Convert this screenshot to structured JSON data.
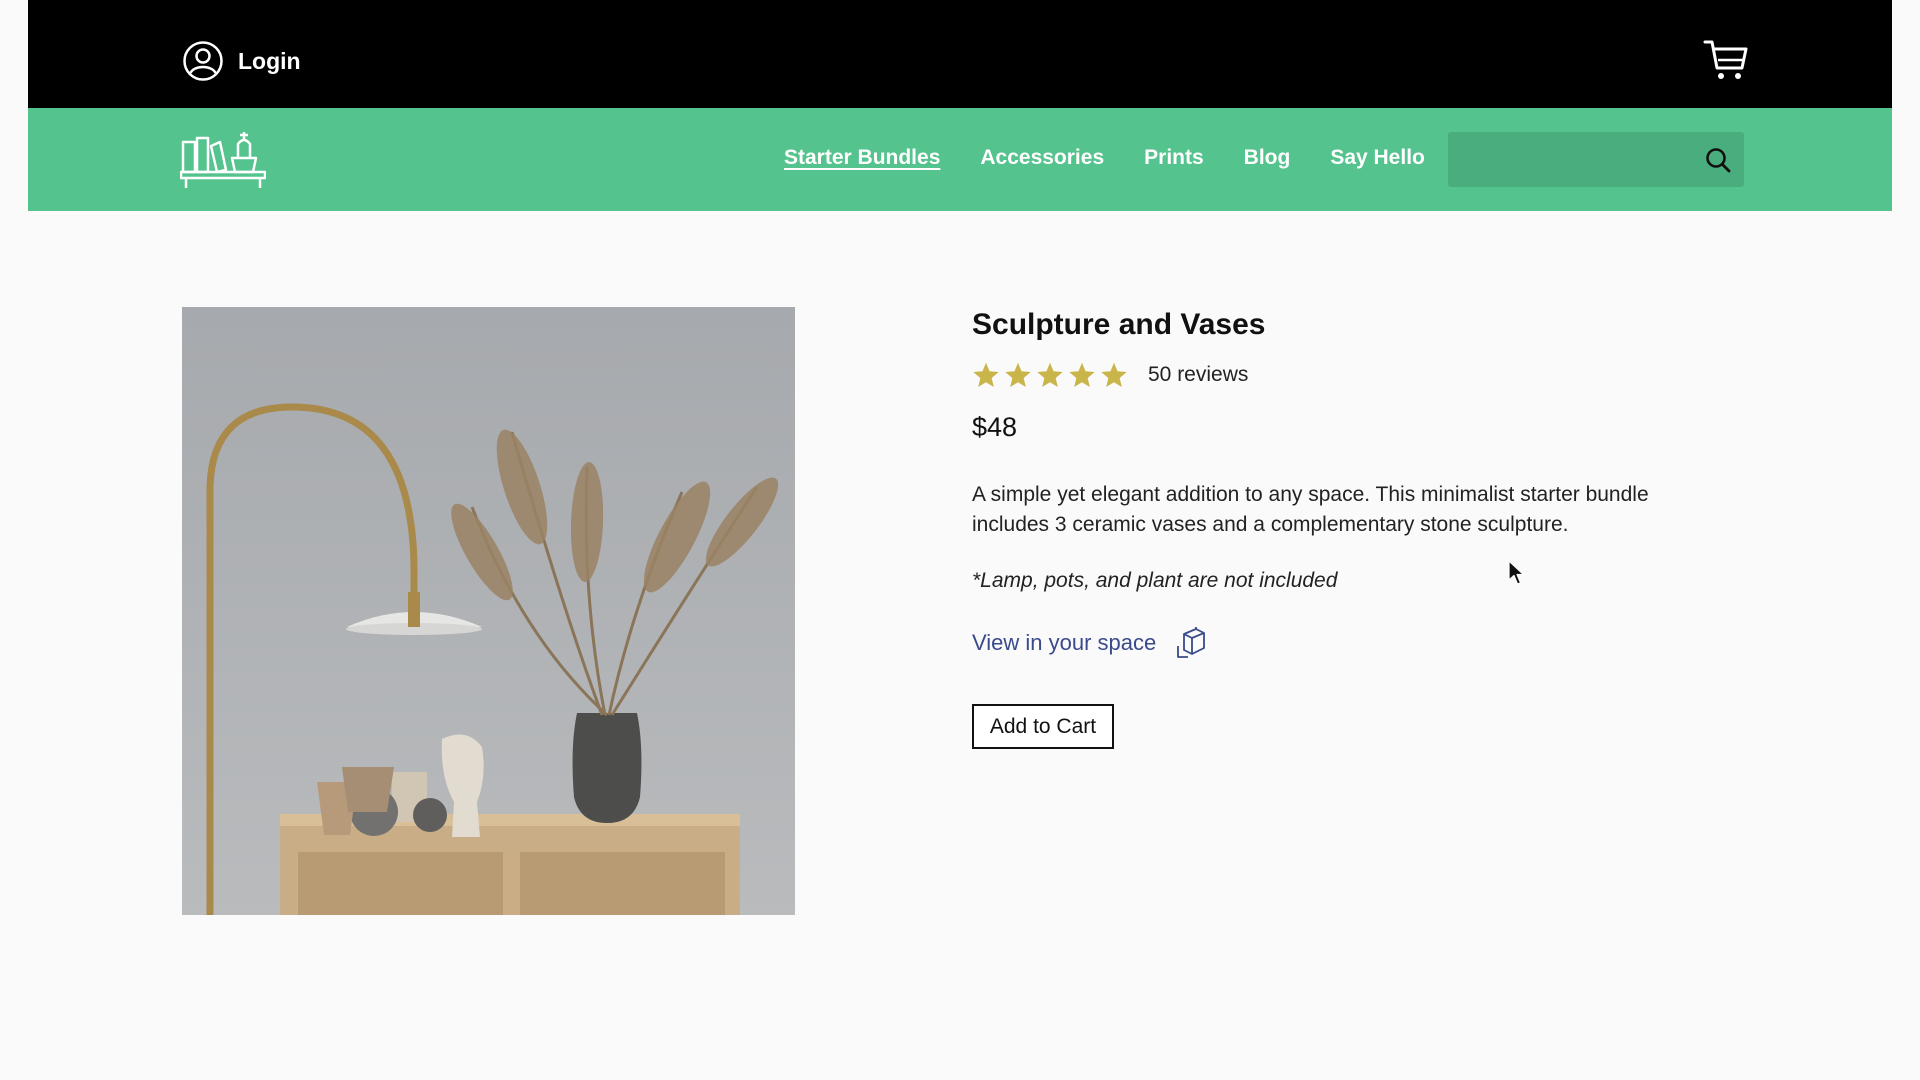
{
  "header": {
    "login_label": "Login",
    "user_icon": "user-circle-icon",
    "cart_icon": "cart-icon"
  },
  "nav": {
    "logo_icon": "bookshelf-logo-icon",
    "items": [
      {
        "label": "Starter Bundles",
        "active": true
      },
      {
        "label": "Accessories",
        "active": false
      },
      {
        "label": "Prints",
        "active": false
      },
      {
        "label": "Blog",
        "active": false
      },
      {
        "label": "Say Hello",
        "active": false
      }
    ],
    "search": {
      "value": "",
      "placeholder": "",
      "icon": "search-icon"
    }
  },
  "product": {
    "image_description_icon": "product-photo",
    "title": "Sculpture and Vases",
    "rating": 5,
    "rating_max": 5,
    "reviews": "50 reviews",
    "price": "$48",
    "description": "A simple yet elegant addition to any space. This minimalist starter bundle includes 3 ceramic vases and a complementary stone sculpture.",
    "note": "*Lamp, pots, and plant are not included",
    "view_in_space": "View in your space",
    "view_icon": "ar-cube-icon",
    "add_to_cart": "Add to Cart"
  },
  "colors": {
    "topbar": "#000000",
    "navbar": "#54c38d",
    "search_bg": "#4aad7d",
    "star": "#c9b54a",
    "link": "#3a4a8a"
  }
}
